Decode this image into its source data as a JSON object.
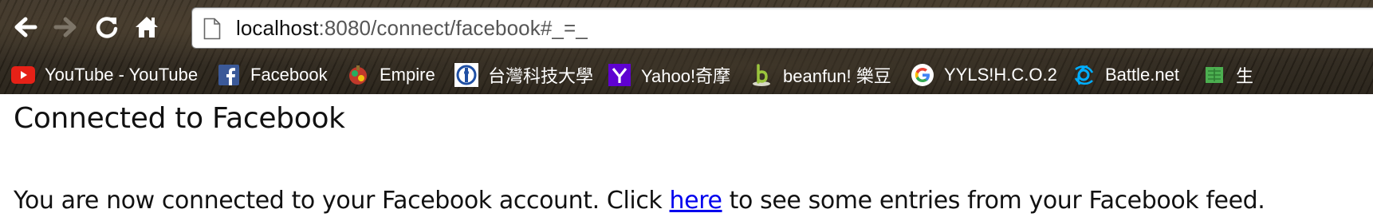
{
  "browser": {
    "url_host": "localhost",
    "url_rest": ":8080/connect/facebook#_=_"
  },
  "bookmarks": [
    {
      "label": "YouTube - YouTube",
      "icon": "youtube-icon"
    },
    {
      "label": "Facebook",
      "icon": "facebook-icon"
    },
    {
      "label": "Empire",
      "icon": "empire-icon"
    },
    {
      "label": "台灣科技大學",
      "icon": "ntust-icon"
    },
    {
      "label": "Yahoo!奇摩",
      "icon": "yahoo-icon"
    },
    {
      "label": "beanfun! 樂豆",
      "icon": "beanfun-icon"
    },
    {
      "label": "YYLS!H.C.O.2",
      "icon": "google-icon"
    },
    {
      "label": "Battle.net",
      "icon": "battlenet-icon"
    },
    {
      "label": "生",
      "icon": "folder-icon"
    }
  ],
  "page": {
    "heading": "Connected to Facebook",
    "text_before_link": "You are now connected to your Facebook account. Click ",
    "link_text": "here",
    "text_after_link": " to see some entries from your Facebook feed."
  },
  "colors": {
    "link": "#0000ee",
    "chrome_background": "#2f281e"
  }
}
